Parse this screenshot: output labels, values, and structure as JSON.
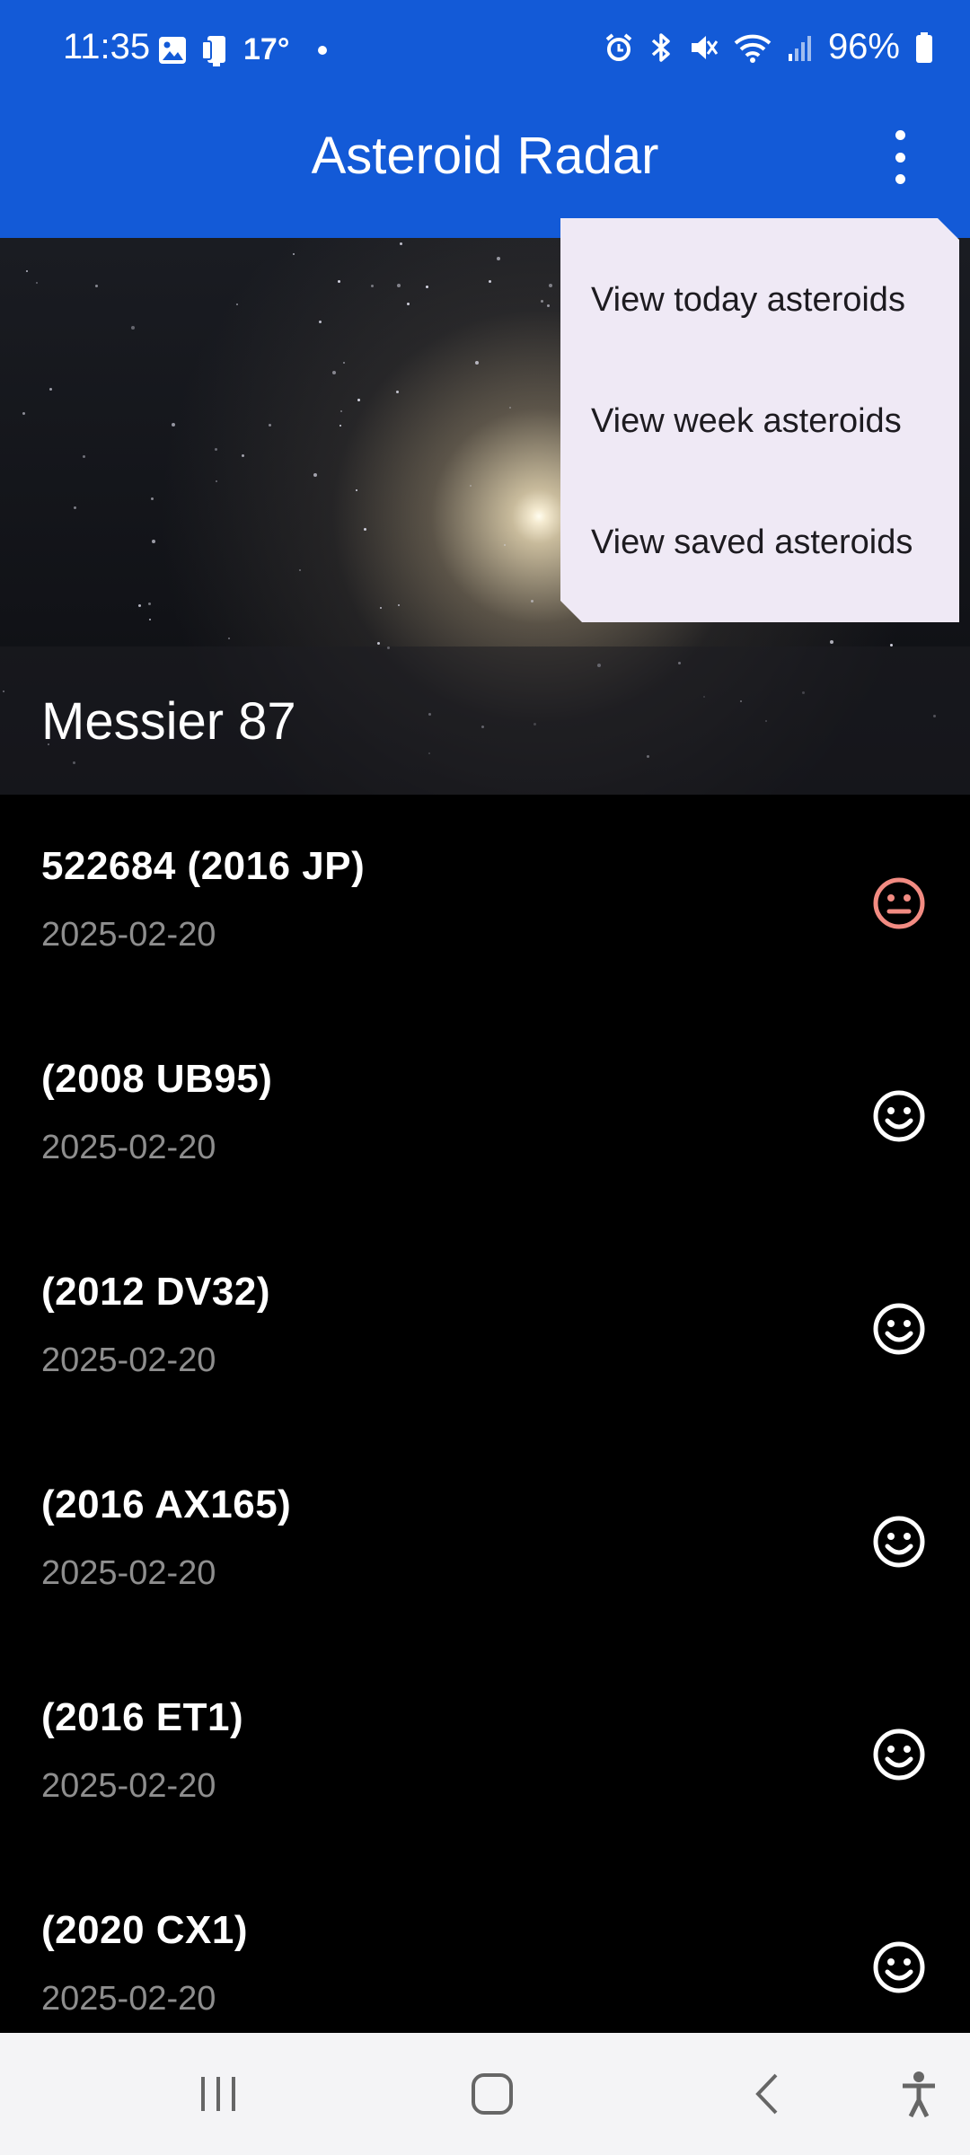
{
  "status_bar": {
    "time": "11:35",
    "temperature": "17°",
    "battery": "96%",
    "icons": [
      "gallery-icon",
      "device-icon",
      "alarm-icon",
      "bluetooth-icon",
      "mute-icon",
      "wifi-icon",
      "signal-icon",
      "battery-icon"
    ]
  },
  "app_bar": {
    "title": "Asteroid Radar",
    "overflow_icon": "more-vert-icon"
  },
  "hero": {
    "title": "Messier 87"
  },
  "asteroids": [
    {
      "name": "522684 (2016 JP)",
      "date": "2025-02-20",
      "status": "hazardous"
    },
    {
      "name": "(2008 UB95)",
      "date": "2025-02-20",
      "status": "safe"
    },
    {
      "name": "(2012 DV32)",
      "date": "2025-02-20",
      "status": "safe"
    },
    {
      "name": "(2016 AX165)",
      "date": "2025-02-20",
      "status": "safe"
    },
    {
      "name": "(2016 ET1)",
      "date": "2025-02-20",
      "status": "safe"
    },
    {
      "name": "(2020 CX1)",
      "date": "2025-02-20",
      "status": "safe"
    }
  ],
  "menu": {
    "items": [
      {
        "label": "View today asteroids"
      },
      {
        "label": "View week asteroids"
      },
      {
        "label": "View saved asteroids"
      }
    ]
  },
  "colors": {
    "app_bar": "#135ad7",
    "hazardous": "#f28b82",
    "safe": "#ffffff",
    "menu_bg": "#efe9f5"
  },
  "nav": {
    "icons": [
      "recents-icon",
      "home-icon",
      "back-icon",
      "accessibility-icon"
    ]
  }
}
